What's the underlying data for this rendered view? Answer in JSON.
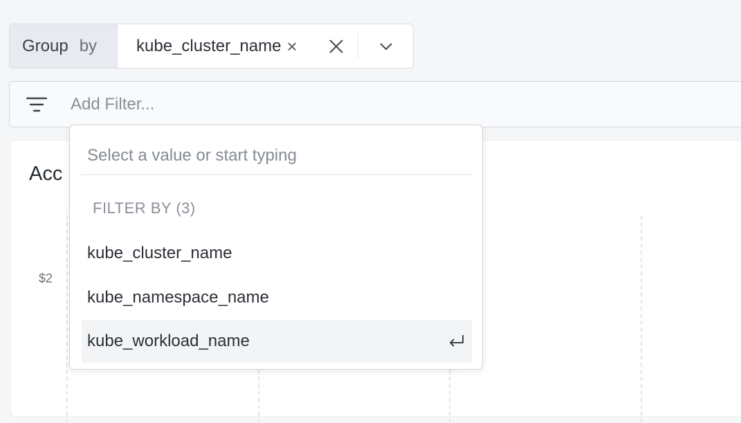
{
  "group_by": {
    "label_word1": "Group",
    "label_word2": "by",
    "chip": "kube_cluster_name"
  },
  "filter": {
    "placeholder": "Add Filter..."
  },
  "card": {
    "title": "Acc",
    "y_tick": "$2"
  },
  "dropdown": {
    "search_placeholder": "Select a value or start typing",
    "section_title": "FILTER BY (3)",
    "items": [
      {
        "label": "kube_cluster_name"
      },
      {
        "label": "kube_namespace_name"
      },
      {
        "label": "kube_workload_name"
      }
    ],
    "active_index": 2
  },
  "icons": {
    "chip_remove": "close-icon",
    "clear_all": "close-icon",
    "expand": "chevron-down-icon",
    "filter": "filter-lines-icon",
    "enter": "enter-return-icon"
  }
}
